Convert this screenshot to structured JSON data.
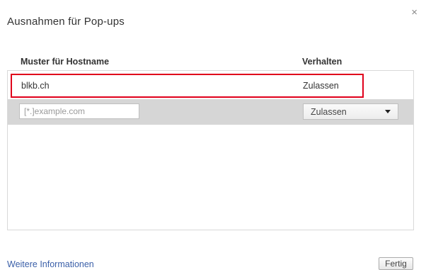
{
  "dialog": {
    "title": "Ausnahmen für Pop-ups",
    "close_glyph": "×"
  },
  "table": {
    "headers": {
      "host": "Muster für Hostname",
      "behavior": "Verhalten"
    },
    "rows": [
      {
        "host": "blkb.ch",
        "behavior": "Zulassen",
        "highlighted": true
      }
    ],
    "new_entry": {
      "host_placeholder": "[*.]example.com",
      "host_value": "",
      "behavior_selected": "Zulassen"
    }
  },
  "footer": {
    "more_info_link": "Weitere Informationen",
    "done_label": "Fertig"
  },
  "colors": {
    "highlight_border": "#e0001b",
    "link": "#3a5fa8",
    "new_row_background": "#d6d6d6"
  },
  "icons": {
    "close": "close-icon",
    "dropdown": "chevron-down-icon"
  }
}
